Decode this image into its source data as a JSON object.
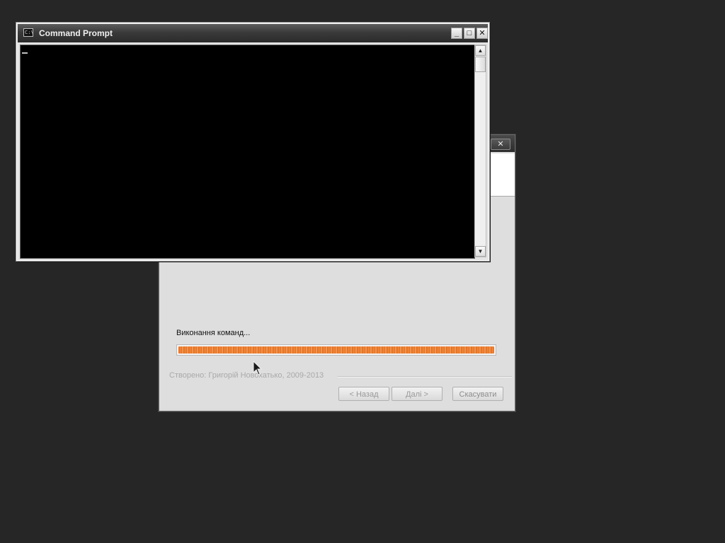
{
  "cmd_window": {
    "title": "Command Prompt",
    "icon": "cmd-icon",
    "icon_text": "C:\\",
    "minimize_glyph": "_",
    "maximize_glyph": "□",
    "close_glyph": "✕",
    "cursor": "_"
  },
  "installer": {
    "close_glyph": "✕",
    "status": "Виконання команд...",
    "progress_percent": 100,
    "credit": "Створено: Григорій Новохатько, 2009-2013",
    "buttons": {
      "back": "< Назад",
      "next": "Далі >",
      "cancel": "Скасувати"
    },
    "buttons_enabled": {
      "back": false,
      "next": false,
      "cancel": false
    }
  },
  "colors": {
    "desktop": "#262626",
    "progress": "#e56a1c",
    "console": "#000000"
  }
}
